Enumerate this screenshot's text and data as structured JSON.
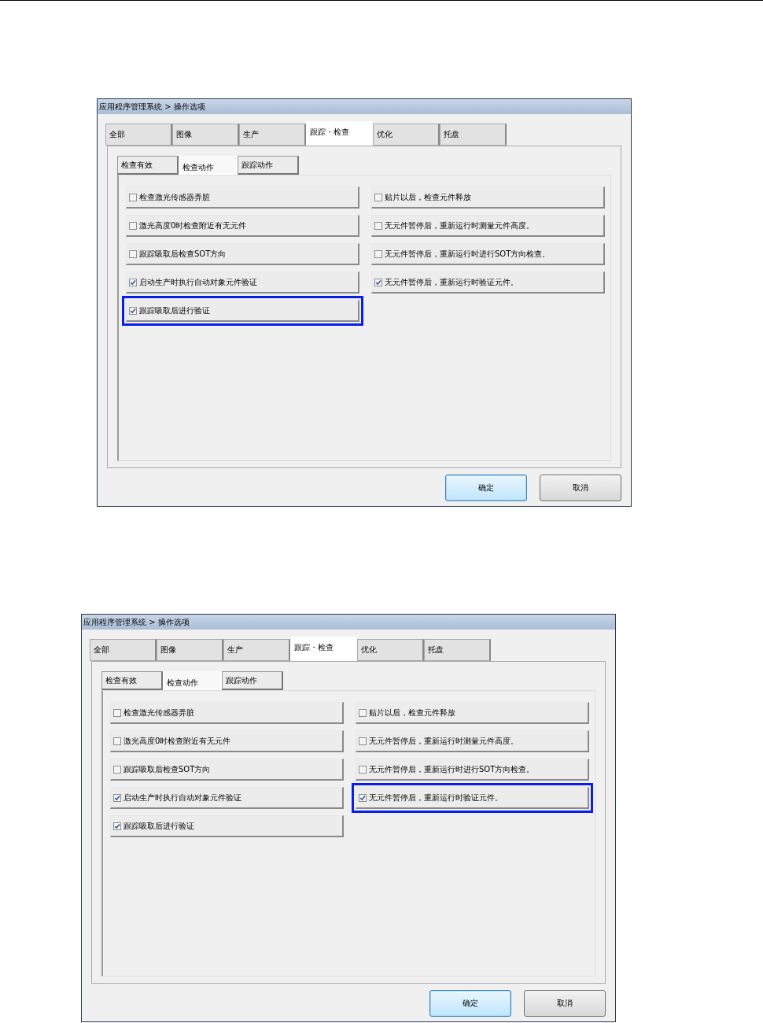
{
  "dialogs": [
    {
      "title": "应用程序管理系统 > 操作选项",
      "tabs": [
        {
          "label": "全部",
          "selected": false
        },
        {
          "label": "图像",
          "selected": false
        },
        {
          "label": "生产",
          "selected": false
        },
        {
          "label": "跟踪・检查",
          "selected": true
        },
        {
          "label": "优化",
          "selected": false
        },
        {
          "label": "托盘",
          "selected": false
        }
      ],
      "subtabs": [
        {
          "label": "检查有效",
          "selected": false
        },
        {
          "label": "检查动作",
          "selected": true
        },
        {
          "label": "跟踪动作",
          "selected": false
        }
      ],
      "left_options": [
        {
          "label": "检查激光传感器弄脏",
          "checked": false,
          "highlighted": false
        },
        {
          "label": "激光高度0时检查附近有无元件",
          "checked": false,
          "highlighted": false
        },
        {
          "label": "跟踪吸取后检查SOT方向",
          "checked": false,
          "highlighted": false
        },
        {
          "label": "启动生产时执行自动对象元件验证",
          "checked": true,
          "highlighted": false
        },
        {
          "label": "跟踪吸取后进行验证",
          "checked": true,
          "highlighted": true
        }
      ],
      "right_options": [
        {
          "label": "贴片以后，检查元件释放",
          "checked": false,
          "highlighted": false
        },
        {
          "label": "无元件暂停后，重新运行时测量元件高度。",
          "checked": false,
          "highlighted": false
        },
        {
          "label": "无元件暂停后，重新运行时进行SOT方向检查。",
          "checked": false,
          "highlighted": false
        },
        {
          "label": "无元件暂停后，重新运行时验证元件。",
          "checked": true,
          "highlighted": false
        }
      ],
      "buttons": [
        {
          "label": "确定",
          "default": true
        },
        {
          "label": "取消",
          "default": false
        }
      ]
    },
    {
      "title": "应用程序管理系统 > 操作选项",
      "tabs": [
        {
          "label": "全部",
          "selected": false
        },
        {
          "label": "图像",
          "selected": false
        },
        {
          "label": "生产",
          "selected": false
        },
        {
          "label": "跟踪・检查",
          "selected": true
        },
        {
          "label": "优化",
          "selected": false
        },
        {
          "label": "托盘",
          "selected": false
        }
      ],
      "subtabs": [
        {
          "label": "检查有效",
          "selected": false
        },
        {
          "label": "检查动作",
          "selected": true
        },
        {
          "label": "跟踪动作",
          "selected": false
        }
      ],
      "left_options": [
        {
          "label": "检查激光传感器弄脏",
          "checked": false,
          "highlighted": false
        },
        {
          "label": "激光高度0时检查附近有无元件",
          "checked": false,
          "highlighted": false
        },
        {
          "label": "跟踪吸取后检查SOT方向",
          "checked": false,
          "highlighted": false
        },
        {
          "label": "启动生产时执行自动对象元件验证",
          "checked": true,
          "highlighted": false
        },
        {
          "label": "跟踪吸取后进行验证",
          "checked": true,
          "highlighted": false
        }
      ],
      "right_options": [
        {
          "label": "贴片以后，检查元件释放",
          "checked": false,
          "highlighted": false
        },
        {
          "label": "无元件暂停后，重新运行时测量元件高度。",
          "checked": false,
          "highlighted": false
        },
        {
          "label": "无元件暂停后，重新运行时进行SOT方向检查。",
          "checked": false,
          "highlighted": false
        },
        {
          "label": "无元件暂停后，重新运行时验证元件。",
          "checked": true,
          "highlighted": true
        }
      ],
      "buttons": [
        {
          "label": "确定",
          "default": true
        },
        {
          "label": "取消",
          "default": false
        }
      ]
    }
  ]
}
